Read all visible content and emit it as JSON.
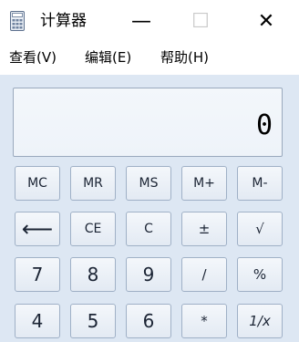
{
  "window": {
    "title": "计算器",
    "minimize_glyph": "—",
    "maximize_glyph": "☐",
    "close_glyph": "✕"
  },
  "menu": {
    "items": [
      {
        "label": "查看(V)"
      },
      {
        "label": "编辑(E)"
      },
      {
        "label": "帮助(H)"
      }
    ]
  },
  "display": {
    "value": "0"
  },
  "buttons": {
    "row1": [
      {
        "label": "MC"
      },
      {
        "label": "MR"
      },
      {
        "label": "MS"
      },
      {
        "label": "M+"
      },
      {
        "label": "M-"
      }
    ],
    "row2": [
      {
        "label": "⟵"
      },
      {
        "label": "CE"
      },
      {
        "label": "C"
      },
      {
        "label": "±"
      },
      {
        "label": "√"
      }
    ],
    "row3": [
      {
        "label": "7"
      },
      {
        "label": "8"
      },
      {
        "label": "9"
      },
      {
        "label": "/"
      },
      {
        "label": "%"
      }
    ],
    "row4": [
      {
        "label": "4"
      },
      {
        "label": "5"
      },
      {
        "label": "6"
      },
      {
        "label": "*"
      },
      {
        "label": "1/x"
      }
    ]
  },
  "colors": {
    "client_background": "#dde7f3",
    "button_border": "#9fb0c6",
    "text": "#1b2434"
  }
}
